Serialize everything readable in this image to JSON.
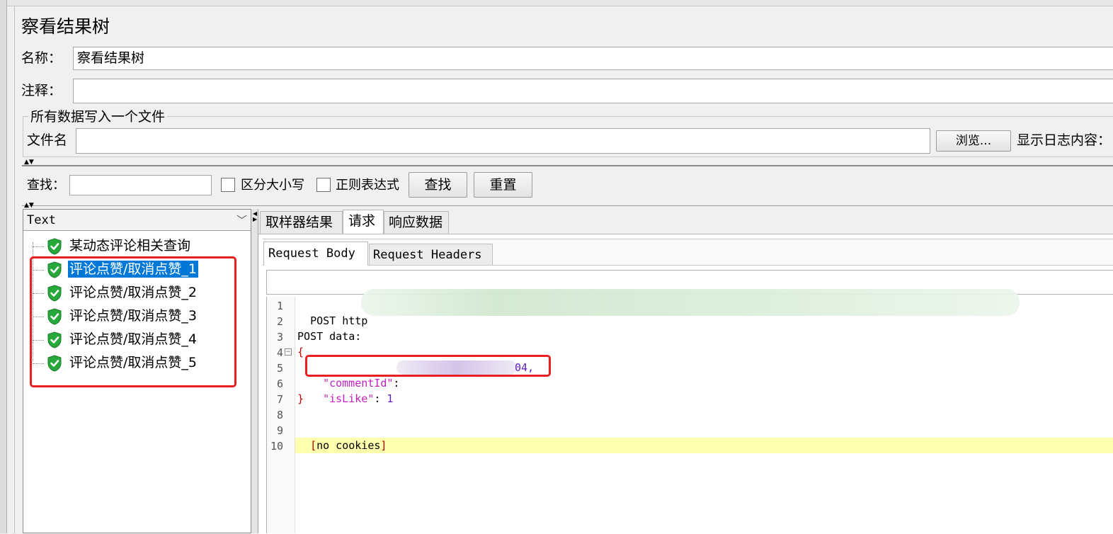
{
  "title": "察看结果树",
  "form": {
    "name_label": "名称：",
    "name_value": "察看结果树",
    "comment_label": "注释：",
    "comment_value": ""
  },
  "file_section": {
    "legend": "所有数据写入一个文件",
    "filename_label": "文件名",
    "filename_value": "",
    "browse_button": "浏览...",
    "show_log_label": "显示日志内容："
  },
  "search": {
    "label": "查找：",
    "value": "",
    "case_label": "区分大小写",
    "case_checked": false,
    "regex_label": "正则表达式",
    "regex_checked": false,
    "find_button": "查找",
    "reset_button": "重置"
  },
  "renderer": {
    "selected": "Text"
  },
  "tree": {
    "items": [
      {
        "label": "某动态评论相关查询",
        "selected": false,
        "status": "success"
      },
      {
        "label": "评论点赞/取消点赞_1",
        "selected": true,
        "status": "success"
      },
      {
        "label": "评论点赞/取消点赞_2",
        "selected": false,
        "status": "success"
      },
      {
        "label": "评论点赞/取消点赞_3",
        "selected": false,
        "status": "success"
      },
      {
        "label": "评论点赞/取消点赞_4",
        "selected": false,
        "status": "success"
      },
      {
        "label": "评论点赞/取消点赞_5",
        "selected": false,
        "status": "success"
      }
    ]
  },
  "tabs": {
    "main": [
      "取样器结果",
      "请求",
      "响应数据"
    ],
    "main_active": "请求",
    "sub": [
      "Request Body",
      "Request Headers"
    ],
    "sub_active": "Request Body"
  },
  "editor": {
    "line_numbers": [
      "1",
      "2",
      "3",
      "4",
      "5",
      "6",
      "7",
      "8",
      "9",
      "10"
    ],
    "line1_method": "POST http",
    "line3": "POST data:",
    "open_brace": "{",
    "key_comment": "\"commentId\"",
    "colon": ":",
    "comment_suffix": "04,",
    "key_islike": "\"isLike\"",
    "islike_value": "1",
    "close_brace": "}",
    "bracket_open": "[",
    "no_cookies": "no cookies",
    "bracket_close": "]"
  },
  "colors": {
    "highlight": "#0078d7",
    "annotation_red": "#e62020",
    "success_green": "#27a83a",
    "current_line": "#ffffb0"
  }
}
